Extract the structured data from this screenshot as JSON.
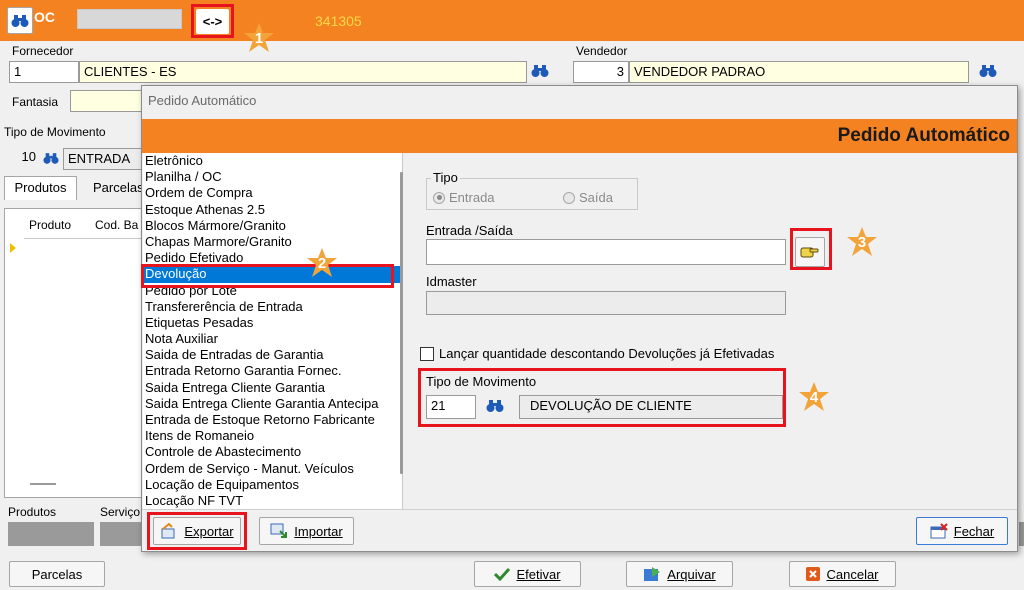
{
  "titlebar": {
    "module": "OC",
    "arrows": "<->",
    "number": "341305"
  },
  "form": {
    "fornecedor_label": "Fornecedor",
    "fornecedor_code": "1",
    "fornecedor_name": "CLIENTES - ES",
    "vendedor_label": "Vendedor",
    "vendedor_code": "3",
    "vendedor_name": "VENDEDOR PADRAO",
    "fantasia_label": "Fantasia",
    "tipo_mov_label": "Tipo  de Movimento",
    "tipo_mov_code": "10",
    "tipo_mov_name": "ENTRADA",
    "tabs": [
      "Produtos",
      "Parcelas"
    ],
    "grid_headers": [
      "Produto",
      "Cod. Ba"
    ],
    "bottom_labels": [
      "Produtos",
      "Serviço"
    ],
    "parcelas_button": "Parcelas",
    "efetivar_button": "Efetivar",
    "arquivar_button": "Arquivar",
    "cancelar_button": "Cancelar"
  },
  "dialog": {
    "window_title": "Pedido Automático",
    "header": "Pedido Automático",
    "list_items": [
      "Eletrônico",
      "Planilha / OC",
      "Ordem de Compra",
      "Estoque Athenas 2.5",
      "Blocos Mármore/Granito",
      "Chapas Marmore/Granito",
      "Pedido Efetivado",
      "Devolução",
      "Pedido por Lote",
      "Transfererência de Entrada",
      "Etiquetas Pesadas",
      "Nota Auxiliar",
      "Saida de Entradas de Garantia",
      "Entrada Retorno Garantia Fornec.",
      "Saida Entrega Cliente Garantia",
      "Saida Entrega Cliente Garantia Antecipa",
      "Entrada de Estoque Retorno Fabricante",
      "Itens de Romaneio",
      "Controle de Abastecimento",
      "Ordem de Serviço - Manut. Veículos",
      "Locação de Equipamentos",
      "Locação NF                  TVT"
    ],
    "selected_index": 7,
    "tipo_label": "Tipo",
    "radio_entrada": "Entrada",
    "radio_saida": "Saída",
    "entrada_saida_label": "Entrada /Saída",
    "idmaster_label": "Idmaster",
    "checkbox_label": "Lançar quantidade descontando Devoluções já Efetivadas",
    "tipo_movimento_label": "Tipo de Movimento",
    "tipo_movimento_code": "21",
    "tipo_movimento_name": "DEVOLUÇÃO DE CLIENTE",
    "exportar": "Exportar",
    "importar": "Importar",
    "fechar": "Fechar"
  },
  "annotations": [
    "1",
    "2",
    "3",
    "4"
  ],
  "colors": {
    "orange": "#f58220",
    "red_box": "#e8141d",
    "select": "#0078d7",
    "yellow_field": "#ffffe1"
  }
}
